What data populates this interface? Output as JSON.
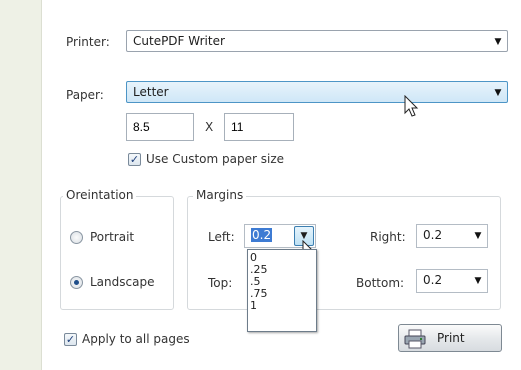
{
  "printer": {
    "label": "Printer:",
    "value": "CutePDF Writer"
  },
  "paper": {
    "label": "Paper:",
    "value": "Letter",
    "width": "8.5",
    "separator": "X",
    "height": "11",
    "custom_label": "Use Custom paper size"
  },
  "orientation": {
    "legend": "Oreintation",
    "portrait": "Portrait",
    "landscape": "Landscape"
  },
  "margins": {
    "legend": "Margins",
    "left_label": "Left:",
    "left_value": "0.2",
    "right_label": "Right:",
    "right_value": "0.2",
    "top_label": "Top:",
    "bottom_label": "Bottom:",
    "bottom_value": "0.2",
    "options": [
      "0",
      ".25",
      ".5",
      ".75",
      "1"
    ]
  },
  "apply_all": "Apply to all pages",
  "print_button": "Print",
  "icons": {
    "dropdown": "triangle-down",
    "check": "checkmark",
    "cursor": "mouse-pointer",
    "print": "printer"
  }
}
